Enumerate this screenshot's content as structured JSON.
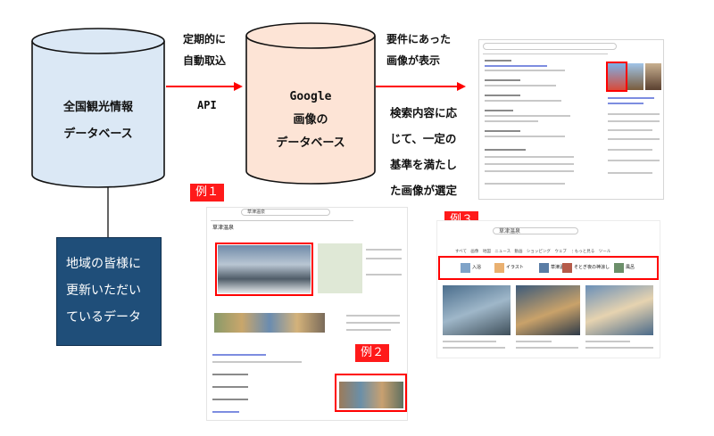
{
  "source_db": {
    "lines": [
      "全国観光情報",
      "データベース"
    ],
    "fill": "#dbe8f5"
  },
  "google_db": {
    "lines": [
      "Google",
      "画像の",
      "データベース"
    ],
    "fill": "#fde4d6"
  },
  "arrow_color": "#ff0000",
  "arrow1": {
    "lines": [
      "定期的に",
      "自動取込"
    ],
    "api": "API"
  },
  "arrow2": {
    "top_lines": [
      "要件にあった",
      "画像が表示"
    ],
    "bottom_lines": [
      "検索内容に応",
      "じて、一定の",
      "基準を満たし",
      "た画像が選定"
    ]
  },
  "local_box": {
    "lines": [
      "地域の皆様に",
      "更新いただい",
      "ているデータ"
    ],
    "fill": "#1f4e79"
  },
  "examples": {
    "ex1": "例１",
    "ex2": "例２",
    "ex3": "例３"
  },
  "ex3_shot": {
    "search_text": "草津温泉",
    "chips": [
      "入浴",
      "イラスト",
      "草津温",
      "そとぎ夜の神涼し",
      "風呂"
    ]
  },
  "ex1_shot": {
    "search_text": "草津温泉",
    "title": "草津温泉"
  }
}
